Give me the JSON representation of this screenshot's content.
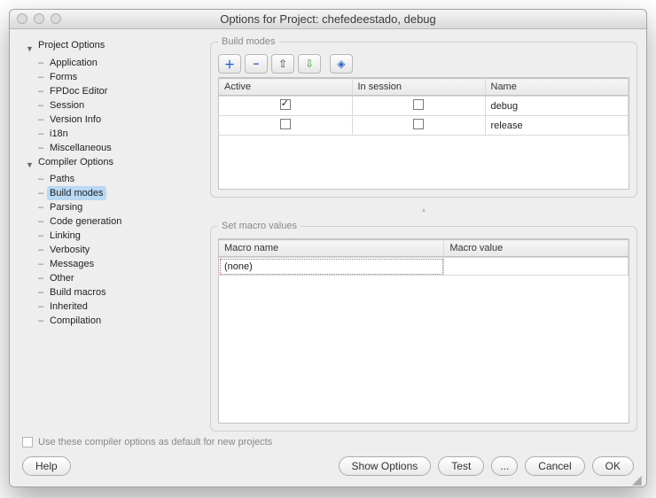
{
  "window": {
    "title": "Options for Project: chefedeestado, debug"
  },
  "tree": {
    "project_options": {
      "label": "Project Options",
      "items": [
        {
          "label": "Application"
        },
        {
          "label": "Forms"
        },
        {
          "label": "FPDoc Editor"
        },
        {
          "label": "Session"
        },
        {
          "label": "Version Info"
        },
        {
          "label": "i18n"
        },
        {
          "label": "Miscellaneous"
        }
      ]
    },
    "compiler_options": {
      "label": "Compiler Options",
      "items": [
        {
          "label": "Paths"
        },
        {
          "label": "Build modes",
          "selected": true
        },
        {
          "label": "Parsing"
        },
        {
          "label": "Code generation"
        },
        {
          "label": "Linking"
        },
        {
          "label": "Verbosity"
        },
        {
          "label": "Messages"
        },
        {
          "label": "Other"
        },
        {
          "label": "Build macros"
        },
        {
          "label": "Inherited"
        },
        {
          "label": "Compilation"
        }
      ]
    }
  },
  "build_modes": {
    "legend": "Build modes",
    "headers": {
      "active": "Active",
      "in_session": "In session",
      "name": "Name"
    },
    "rows": [
      {
        "active": true,
        "in_session": false,
        "name": "debug"
      },
      {
        "active": false,
        "in_session": false,
        "name": "release"
      }
    ]
  },
  "macros": {
    "legend": "Set macro values",
    "headers": {
      "name": "Macro name",
      "value": "Macro value"
    },
    "none_label": "(none)"
  },
  "footer": {
    "default_checkbox": "Use these compiler options as default for new projects",
    "help": "Help",
    "show_options": "Show Options",
    "test": "Test",
    "more": "...",
    "cancel": "Cancel",
    "ok": "OK"
  },
  "toolbar": {
    "add": "＋",
    "remove": "−",
    "up": "⇧",
    "down": "⇩",
    "diff": "◈"
  }
}
